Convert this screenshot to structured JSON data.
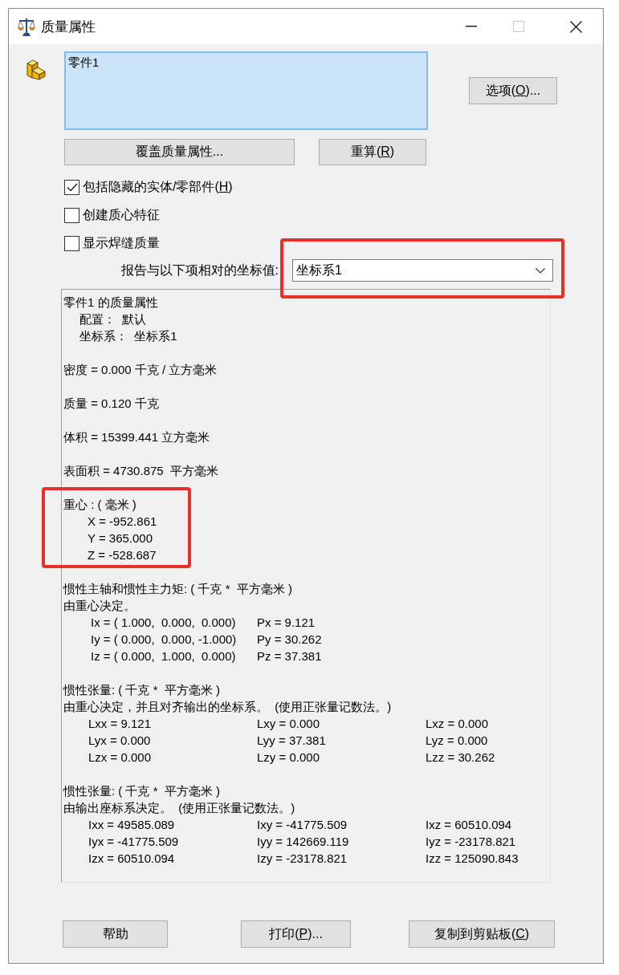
{
  "window": {
    "title": "质量属性",
    "controls": [
      {
        "kind": "minimize",
        "disabled": false
      },
      {
        "kind": "maximize",
        "disabled": true
      },
      {
        "kind": "close",
        "disabled": false
      }
    ]
  },
  "selection": {
    "active": true,
    "items": [
      "零件1"
    ]
  },
  "options_button": {
    "text": "选项(",
    "key": "O",
    "after": ")..."
  },
  "actions": [
    {
      "text": "覆盖质量属性..."
    },
    {
      "text": "重算(",
      "key": "R",
      "after": ")"
    }
  ],
  "checkboxes": [
    {
      "text": "包括隐藏的实体/零部件(",
      "key": "H",
      "after": ")",
      "checked": true
    },
    {
      "text": "创建质心特征",
      "checked": false
    },
    {
      "text": "显示焊缝质量",
      "checked": false
    }
  ],
  "coordinate_system": {
    "label": "报告与以下项相对的坐标值:",
    "value": "坐标系1",
    "highlighted": true
  },
  "report": {
    "sections": [
      {
        "kind": "summary",
        "highlighted": false,
        "lines": [
          "零件1 的质量属性"
        ],
        "items": [
          "配置：  默认",
          "坐标系：  坐标系1"
        ]
      },
      {
        "kind": "quantity",
        "highlighted": false,
        "lines": [
          "密度 = 0.000 千克 / 立方毫米"
        ]
      },
      {
        "kind": "quantity",
        "highlighted": false,
        "lines": [
          "质量 = 0.120 千克"
        ]
      },
      {
        "kind": "quantity",
        "highlighted": false,
        "lines": [
          "体积 = 15399.441 立方毫米"
        ]
      },
      {
        "kind": "quantity",
        "highlighted": false,
        "lines": [
          "表面积 = 4730.875  平方毫米"
        ]
      },
      {
        "kind": "center",
        "highlighted": true,
        "lines": [
          "重心 : ( 毫米 )"
        ],
        "items": [
          "X = -952.861",
          "Y = 365.000",
          "Z = -528.687"
        ]
      },
      {
        "kind": "axes",
        "highlighted": false,
        "lines": [
          "惯性主轴和惯性主力矩: ( 千克 *  平方毫米 )",
          "由重心决定。"
        ],
        "rows": [
          [
            "Ix = ( 1.000,  0.000,  0.000)",
            "Px = 9.121"
          ],
          [
            "Iy = ( 0.000,  0.000, -1.000)",
            "Py = 30.262"
          ],
          [
            "Iz = ( 0.000,  1.000,  0.000)",
            "Pz = 37.381"
          ]
        ]
      },
      {
        "kind": "tensor",
        "highlighted": false,
        "lines": [
          "惯性张量: ( 千克 *  平方毫米 )",
          "由重心决定，并且对齐输出的坐标系。  (使用正张量记数法。)"
        ],
        "rows": [
          [
            "Lxx = 9.121",
            "Lxy = 0.000",
            "Lxz = 0.000"
          ],
          [
            "Lyx = 0.000",
            "Lyy = 37.381",
            "Lyz = 0.000"
          ],
          [
            "Lzx = 0.000",
            "Lzy = 0.000",
            "Lzz = 30.262"
          ]
        ]
      },
      {
        "kind": "tensor",
        "highlighted": false,
        "lines": [
          "惯性张量: ( 千克 *  平方毫米 )",
          "由输出座标系决定。  (使用正张量记数法。)"
        ],
        "rows": [
          [
            "Ixx = 49585.089",
            "Ixy = -41775.509",
            "Ixz = 60510.094"
          ],
          [
            "Iyx = -41775.509",
            "Iyy = 142669.119",
            "Iyz = -23178.821"
          ],
          [
            "Izx = 60510.094",
            "Izy = -23178.821",
            "Izz = 125090.843"
          ]
        ]
      }
    ]
  },
  "footer_buttons": [
    {
      "text": "帮助"
    },
    {
      "text": "打印(",
      "key": "P",
      "after": ")..."
    },
    {
      "text": "复制到剪贴板(",
      "key": "C",
      "after": ")"
    }
  ]
}
